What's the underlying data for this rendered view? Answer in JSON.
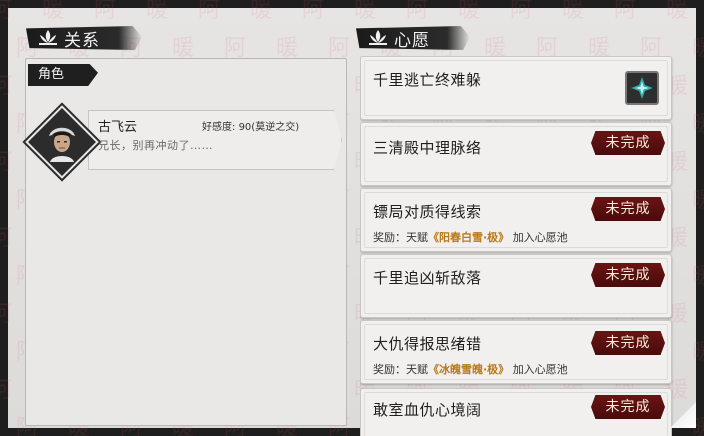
{
  "relation": {
    "header": "关系",
    "tab": "角色",
    "character": {
      "name": "古飞云",
      "favor_label": "好感度:",
      "favor_value": "90(莫逆之交)",
      "quote": "兄长，别再冲动了……"
    }
  },
  "wishes": {
    "header": "心愿",
    "items": [
      {
        "title": "千里逃亡终难躲",
        "status": "",
        "completed": true
      },
      {
        "title": "三清殿中理脉络",
        "status": "未完成",
        "completed": false
      },
      {
        "title": "镖局对质得线索",
        "status": "未完成",
        "completed": false,
        "reward_prefix": "奖励：天赋",
        "reward_talent": "《阳春白雪·极》",
        "reward_suffix": "加入心愿池"
      },
      {
        "title": "千里追凶斩敌落",
        "status": "未完成",
        "completed": false
      },
      {
        "title": "大仇得报思绪错",
        "status": "未完成",
        "completed": false,
        "reward_prefix": "奖励：天赋",
        "reward_talent": "《冰魄雪魄·极》",
        "reward_suffix": "加入心愿池"
      },
      {
        "title": "敢室血仇心境阔",
        "status": "未完成",
        "completed": false
      }
    ]
  },
  "watermark_text": "阿暖",
  "colors": {
    "badge": "#5a1010",
    "talent": "#b87a1a",
    "frame": "#1e1e1e"
  }
}
